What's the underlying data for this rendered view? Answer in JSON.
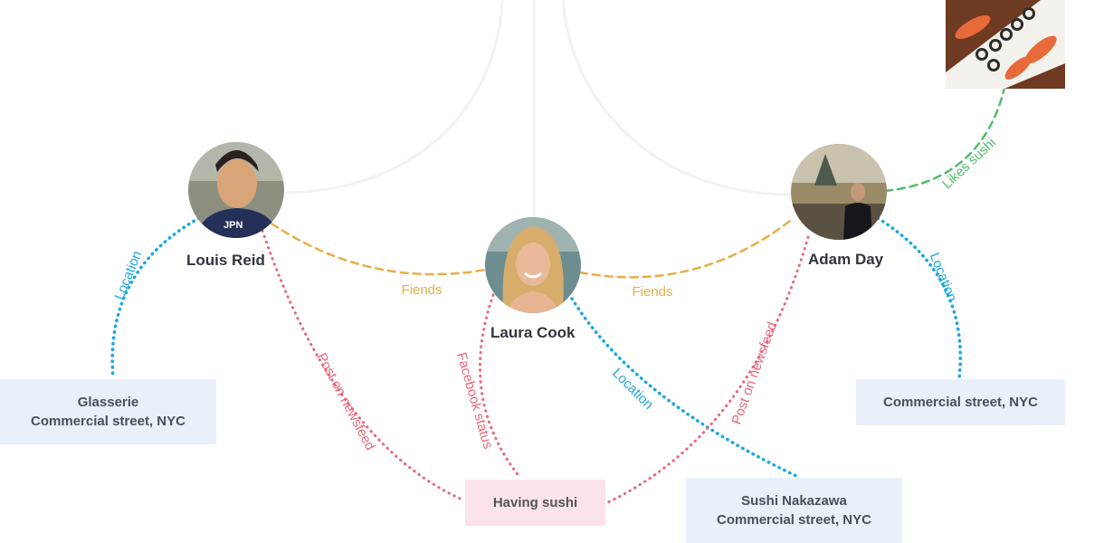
{
  "people": {
    "louis": {
      "name": "Louis Reid"
    },
    "laura": {
      "name": "Laura Cook"
    },
    "adam": {
      "name": "Adam Day"
    }
  },
  "boxes": {
    "glasserie": {
      "line1": "Glasserie",
      "line2": "Commercial street, NYC"
    },
    "adam_location": {
      "line1": "Commercial street, NYC"
    },
    "having_sushi": {
      "line1": "Having sushi"
    },
    "sushi_nakazawa": {
      "line1": "Sushi Nakazawa",
      "line2": "Commercial street, NYC"
    }
  },
  "edges": {
    "fiends_left": "Fiends",
    "fiends_right": "Fiends",
    "louis_location": "Location",
    "laura_location": "Location",
    "adam_location": "Location",
    "louis_post": "Post on newsfeed",
    "adam_post": "Post on newsfeed",
    "laura_status": "Facebook status",
    "likes_sushi": "Likes sushi"
  },
  "colors": {
    "friend": "#e9ad48",
    "location": "#1aa7e0",
    "post": "#e8677a",
    "likes": "#4cbf6b",
    "background_arcs": "#f2f2f2"
  }
}
